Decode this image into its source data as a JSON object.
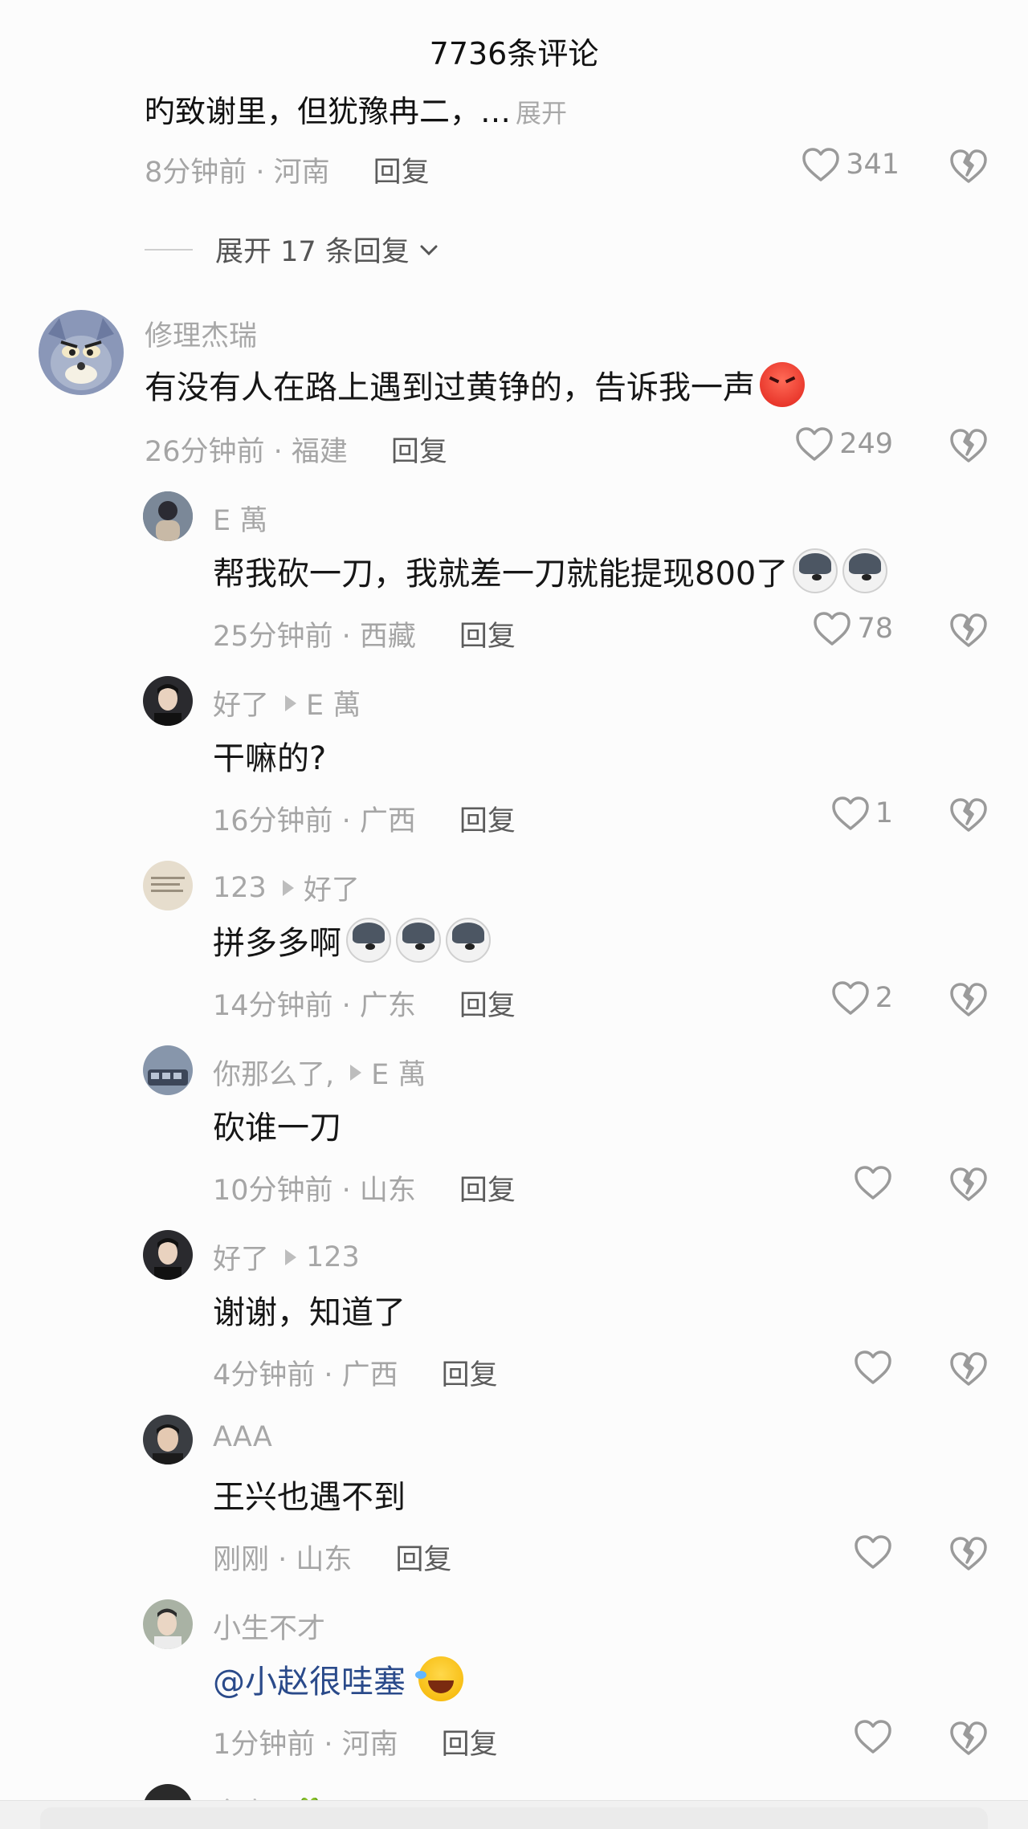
{
  "header": {
    "title": "7736条评论"
  },
  "truncated_comment": {
    "text": "旳致谢里，但犹豫冉二，…",
    "expand_label": "展开",
    "time_location": "8分钟前 · 河南",
    "reply_label": "回复",
    "likes": "341"
  },
  "expand_replies_label": "展开 17 条回复",
  "main_comment": {
    "author": "修理杰瑞",
    "text": "有没有人在路上遇到过黄铮的，告诉我一声",
    "emoji": "angry-face-emoji",
    "time_location": "26分钟前 · 福建",
    "reply_label": "回复",
    "likes": "249"
  },
  "replies": [
    {
      "author": "E 萬",
      "reply_to": "",
      "text": "帮我砍一刀，我就差一刀就能提现800了",
      "emojis": [
        "husky-emoji",
        "husky-emoji"
      ],
      "time_location": "25分钟前 · 西藏",
      "reply_label": "回复",
      "likes": "78"
    },
    {
      "author": "好了",
      "reply_to": "E 萬",
      "text": "干嘛的?",
      "emojis": [],
      "time_location": "16分钟前 · 广西",
      "reply_label": "回复",
      "likes": "1"
    },
    {
      "author": "123",
      "reply_to": "好了",
      "text": "拼多多啊",
      "emojis": [
        "husky-emoji",
        "husky-emoji",
        "husky-emoji"
      ],
      "time_location": "14分钟前 · 广东",
      "reply_label": "回复",
      "likes": "2"
    },
    {
      "author": "你那么了,",
      "reply_to": "E 萬",
      "text": "砍谁一刀",
      "emojis": [],
      "time_location": "10分钟前 · 山东",
      "reply_label": "回复",
      "likes": ""
    },
    {
      "author": "好了",
      "reply_to": "123",
      "text": "谢谢，知道了",
      "emojis": [],
      "time_location": "4分钟前 · 广西",
      "reply_label": "回复",
      "likes": ""
    },
    {
      "author": "AAA",
      "reply_to": "",
      "text": "王兴也遇不到",
      "emojis": [],
      "time_location": "刚刚 · 山东",
      "reply_label": "回复",
      "likes": ""
    },
    {
      "author": "小生不才",
      "reply_to": "",
      "text": "@小赵很哇塞",
      "emojis": [
        "laughing-crying-emoji"
      ],
      "time_location": "1分钟前 · 河南",
      "reply_label": "回复",
      "likes": ""
    }
  ],
  "peek_comment": {
    "author": "今宵⊙🍀"
  },
  "colors": {
    "text": "#161616",
    "muted": "#a5a5a5",
    "mention": "#2a4a8a",
    "background": "#fcfcfc"
  }
}
